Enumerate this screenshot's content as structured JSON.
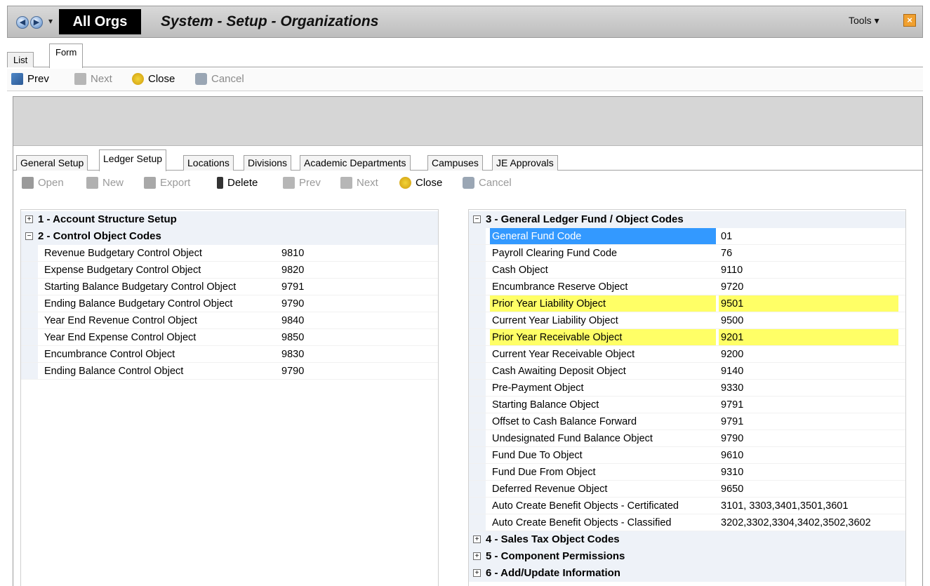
{
  "titlebar": {
    "org_label": "All Orgs",
    "title": "System - Setup - Organizations",
    "tools_label": "Tools ▾"
  },
  "outer_tabs": [
    {
      "label": "List"
    },
    {
      "label": "Form"
    }
  ],
  "toolbar": {
    "prev": "Prev",
    "next": "Next",
    "close": "Close",
    "cancel": "Cancel"
  },
  "inner_tabs": [
    {
      "label": "General Setup"
    },
    {
      "label": "Ledger Setup"
    },
    {
      "label": "Locations"
    },
    {
      "label": "Divisions"
    },
    {
      "label": "Academic Departments"
    },
    {
      "label": "Campuses"
    },
    {
      "label": "JE Approvals"
    }
  ],
  "inner_toolbar": {
    "open": "Open",
    "new": "New",
    "export": "Export",
    "delete": "Delete",
    "prev": "Prev",
    "next": "Next",
    "close": "Close",
    "cancel": "Cancel"
  },
  "left_grid": {
    "cat1": {
      "toggle": "⊞",
      "label": "1 - Account Structure Setup"
    },
    "cat2": {
      "toggle": "⊟",
      "label": "2 - Control Object Codes"
    },
    "rows": [
      {
        "label": "Revenue Budgetary Control Object",
        "value": "9810"
      },
      {
        "label": "Expense Budgetary Control Object",
        "value": "9820"
      },
      {
        "label": "Starting Balance Budgetary Control Object",
        "value": "9791"
      },
      {
        "label": "Ending Balance Budgetary Control Object",
        "value": "9790"
      },
      {
        "label": "Year End Revenue Control Object",
        "value": "9840"
      },
      {
        "label": "Year End Expense Control Object",
        "value": "9850"
      },
      {
        "label": "Encumbrance Control Object",
        "value": "9830"
      },
      {
        "label": "Ending Balance Control Object",
        "value": "9790"
      }
    ]
  },
  "right_grid": {
    "cat3": {
      "toggle": "⊟",
      "label": "3 - General Ledger Fund / Object Codes"
    },
    "rows": [
      {
        "label": "General Fund Code",
        "value": "01"
      },
      {
        "label": "Payroll Clearing Fund Code",
        "value": "76"
      },
      {
        "label": "Cash Object",
        "value": "9110"
      },
      {
        "label": "Encumbrance Reserve Object",
        "value": "9720"
      },
      {
        "label": "Prior Year Liability Object",
        "value": "9501"
      },
      {
        "label": "Current Year Liability Object",
        "value": "9500"
      },
      {
        "label": "Prior Year Receivable Object",
        "value": "9201"
      },
      {
        "label": "Current Year Receivable Object",
        "value": "9200"
      },
      {
        "label": "Cash Awaiting Deposit Object",
        "value": "9140"
      },
      {
        "label": "Pre-Payment Object",
        "value": "9330"
      },
      {
        "label": "Starting Balance Object",
        "value": "9791"
      },
      {
        "label": "Offset to Cash Balance Forward",
        "value": "9791"
      },
      {
        "label": "Undesignated Fund Balance Object",
        "value": "9790"
      },
      {
        "label": "Fund Due To Object",
        "value": "9610"
      },
      {
        "label": "Fund Due From Object",
        "value": "9310"
      },
      {
        "label": "Deferred Revenue Object",
        "value": "9650"
      },
      {
        "label": "Auto Create Benefit Objects - Certificated",
        "value": "3101, 3303,3401,3501,3601"
      },
      {
        "label": "Auto Create Benefit Objects - Classified",
        "value": "3202,3302,3304,3402,3502,3602"
      }
    ],
    "cat4": {
      "toggle": "⊞",
      "label": "4 - Sales Tax Object Codes"
    },
    "cat5": {
      "toggle": "⊞",
      "label": "5 - Component Permissions"
    },
    "cat6": {
      "toggle": "⊞",
      "label": "6 - Add/Update Information"
    }
  },
  "colors": {
    "selection": "#3399ff",
    "highlight": "#ffff66",
    "category_bg": "#eef2f8"
  }
}
